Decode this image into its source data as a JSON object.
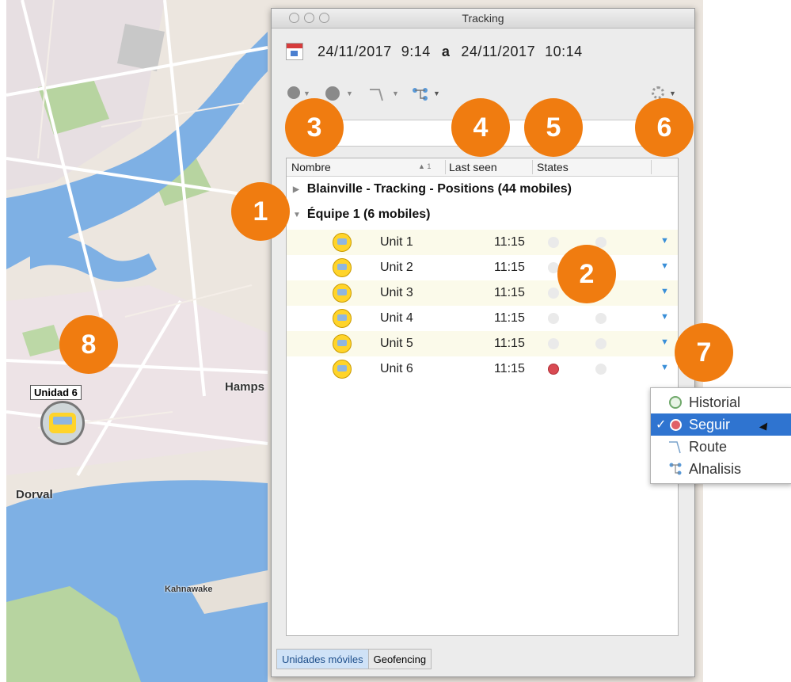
{
  "window": {
    "title": "Tracking"
  },
  "date_range": {
    "from_date": "24/11/2017",
    "from_time": "9:14",
    "separator": "a",
    "to_date": "24/11/2017",
    "to_time": "10:14"
  },
  "table": {
    "headers": {
      "name": "Nombre",
      "sort_indicator": "▲ 1",
      "last_seen": "Last seen",
      "states": "States"
    },
    "groups": [
      {
        "label": "Blainville - Tracking - Positions (44 mobiles)",
        "expanded": false
      },
      {
        "label": "Équipe 1 (6 mobiles)",
        "expanded": true
      }
    ],
    "rows": [
      {
        "name": "Unit 1",
        "time": "11:15"
      },
      {
        "name": "Unit 2",
        "time": "11:15"
      },
      {
        "name": "Unit 3",
        "time": "11:15"
      },
      {
        "name": "Unit 4",
        "time": "11:15"
      },
      {
        "name": "Unit 5",
        "time": "11:15"
      },
      {
        "name": "Unit 6",
        "time": "11:15",
        "active_state": "#d94a52"
      }
    ]
  },
  "badges": [
    "1",
    "2",
    "3",
    "4",
    "5",
    "6",
    "7",
    "8"
  ],
  "tabs": [
    {
      "label": "Unidades móviles",
      "active": true
    },
    {
      "label": "Geofencing",
      "active": false
    }
  ],
  "context_menu": {
    "items": [
      {
        "label": "Historial",
        "icon": "history-icon",
        "checked": false
      },
      {
        "label": "Seguir",
        "icon": "follow-icon",
        "checked": true
      },
      {
        "label": "Route",
        "icon": "route-icon",
        "checked": false
      },
      {
        "label": "Alnalisis",
        "icon": "analysis-icon",
        "checked": false
      }
    ],
    "checkmark": "✓"
  },
  "map": {
    "labels": {
      "hampstead": "Hamps",
      "dorval": "Dorval",
      "kahnawake": "Kahnawake",
      "unit_tag": "Unidad 6"
    }
  },
  "colors": {
    "badge": "#f07c10",
    "selection": "#2f74d0",
    "water": "#7eb0e4",
    "park": "#b7d4a0",
    "alert": "#d94a52"
  }
}
